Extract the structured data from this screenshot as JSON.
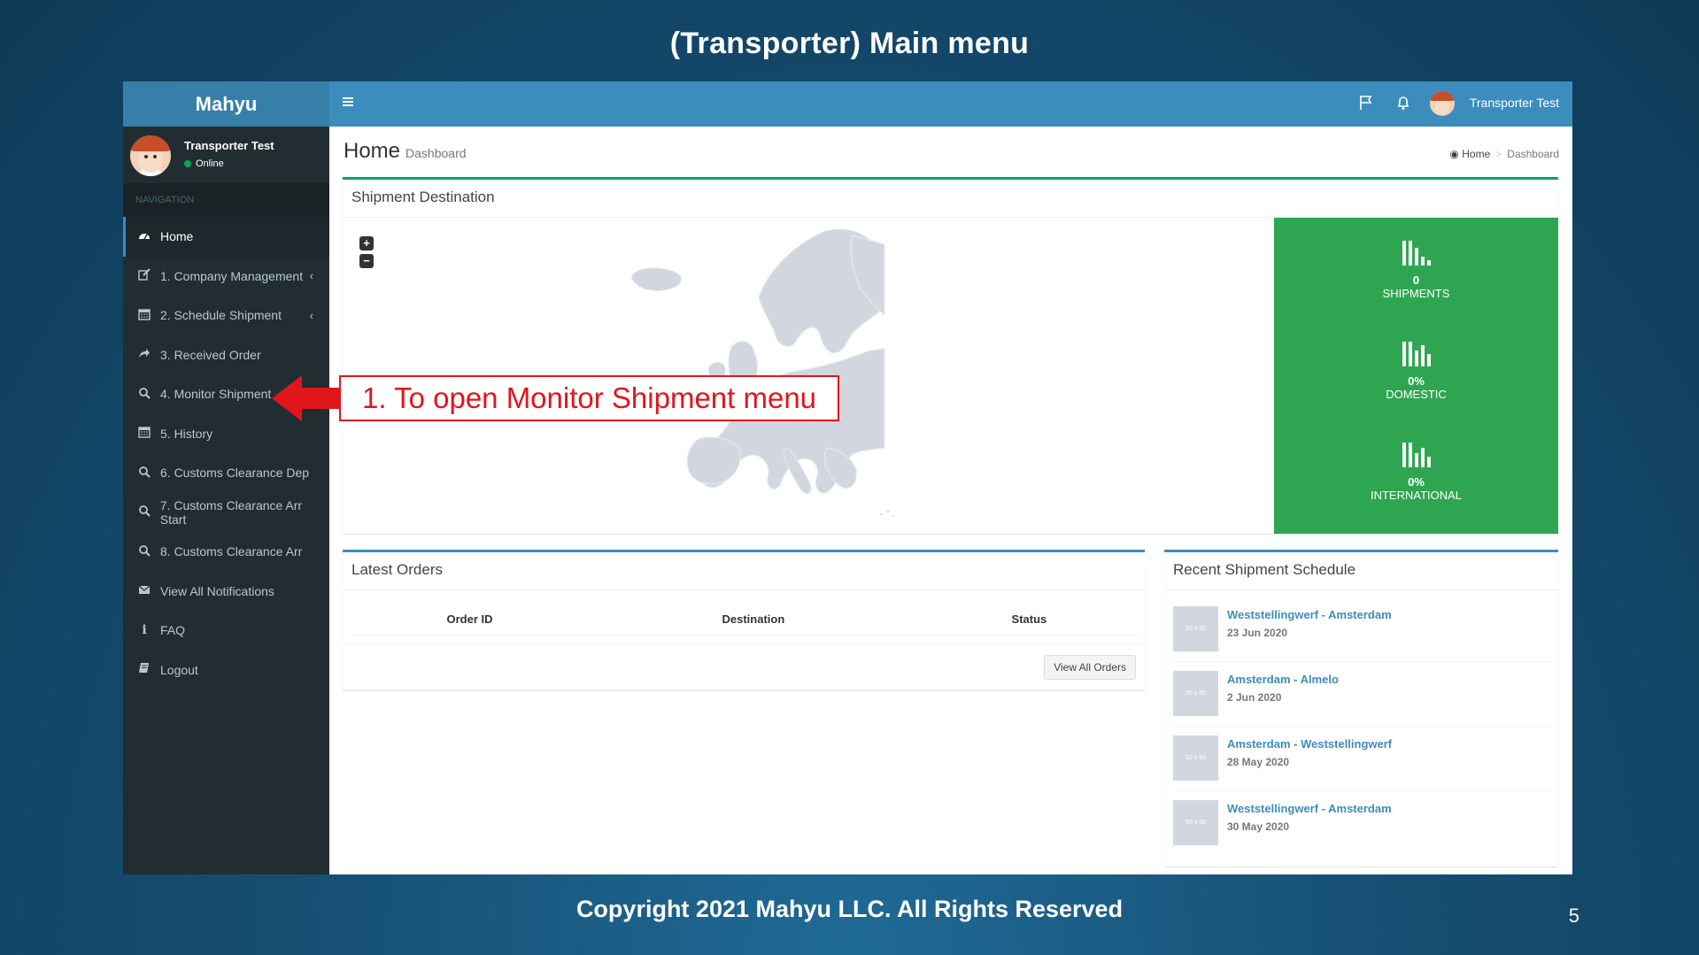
{
  "slide": {
    "title": "(Transporter) Main menu",
    "footer": "Copyright 2021 Mahyu LLC. All Rights Reserved",
    "page_number": "5"
  },
  "app": {
    "logo": "Mahyu",
    "user": {
      "name": "Transporter Test",
      "status": "Online"
    },
    "nav_header": "NAVIGATION",
    "nav": [
      {
        "label": "Home",
        "icon": "dashboard-icon",
        "active": true
      },
      {
        "label": "1. Company Management",
        "icon": "edit-icon",
        "chevron": true
      },
      {
        "label": "2. Schedule Shipment",
        "icon": "calendar-icon",
        "chevron": true
      },
      {
        "label": "3. Received Order",
        "icon": "share-icon"
      },
      {
        "label": "4. Monitor Shipment",
        "icon": "search-icon"
      },
      {
        "label": "5. History",
        "icon": "calendar-icon"
      },
      {
        "label": "6. Customs Clearance Dep",
        "icon": "search-icon"
      },
      {
        "label": "7. Customs Clearance Arr Start",
        "icon": "search-icon"
      },
      {
        "label": "8. Customs Clearance Arr",
        "icon": "search-icon"
      },
      {
        "label": "View All Notifications",
        "icon": "envelope-icon"
      },
      {
        "label": "FAQ",
        "icon": "info-icon"
      },
      {
        "label": "Logout",
        "icon": "book-icon"
      }
    ],
    "topbar": {
      "user_name": "Transporter Test"
    }
  },
  "page": {
    "title": "Home",
    "subtitle": "Dashboard",
    "breadcrumb": {
      "home": "Home",
      "current": "Dashboard"
    }
  },
  "shipment_destination": {
    "title": "Shipment Destination",
    "zoom_in": "+",
    "zoom_out": "−",
    "stats": [
      {
        "value": "0",
        "label": "SHIPMENTS"
      },
      {
        "value": "0%",
        "label": "DOMESTIC"
      },
      {
        "value": "0%",
        "label": "INTERNATIONAL"
      }
    ],
    "colors": {
      "stats_bg": "#2ea651",
      "map_land": "#d2d6de"
    }
  },
  "latest_orders": {
    "title": "Latest Orders",
    "columns": [
      "Order ID",
      "Destination",
      "Status"
    ],
    "view_all_label": "View All Orders"
  },
  "recent_schedule": {
    "title": "Recent Shipment Schedule",
    "thumb_label": "50 x 50",
    "items": [
      {
        "route": "Weststellingwerf - Amsterdam",
        "date": "23 Jun 2020"
      },
      {
        "route": "Amsterdam - Almelo",
        "date": "2 Jun 2020"
      },
      {
        "route": "Amsterdam - Weststellingwerf",
        "date": "28 May 2020"
      },
      {
        "route": "Weststellingwerf - Amsterdam",
        "date": "30 May 2020"
      }
    ]
  },
  "annotation": {
    "text": "1. To open Monitor Shipment menu",
    "color": "#e0161b"
  }
}
